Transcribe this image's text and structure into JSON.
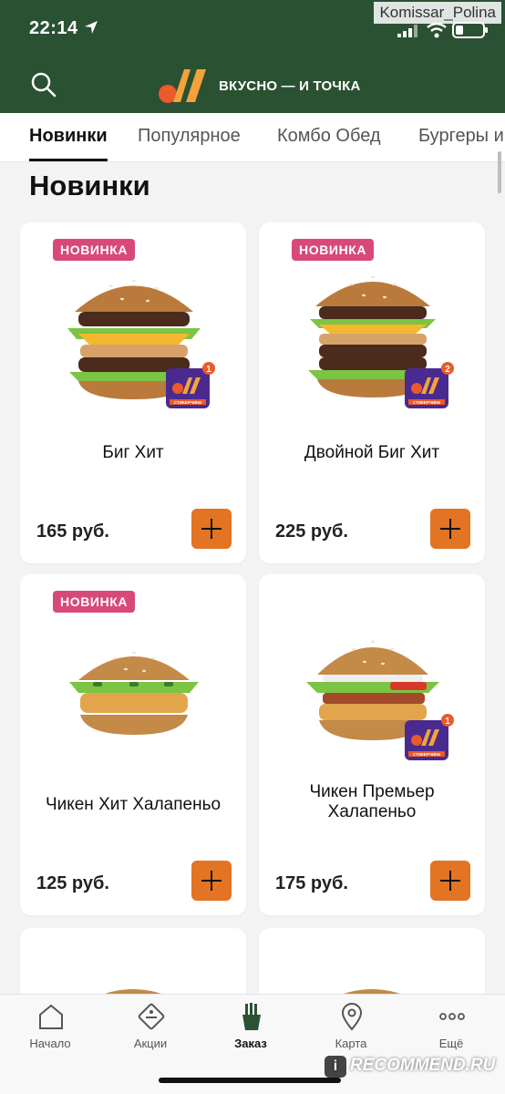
{
  "status_bar": {
    "time": "22:14",
    "watermark": "Komissar_Polina"
  },
  "header": {
    "slogan": "ВКУСНО — И ТОЧКА",
    "brand_color": "#2b5133",
    "accent_color": "#e27424"
  },
  "tabs": [
    {
      "label": "Новинки",
      "active": true
    },
    {
      "label": "Популярное",
      "active": false
    },
    {
      "label": "Комбо Обед",
      "active": false
    },
    {
      "label": "Бургеры и",
      "active": false
    }
  ],
  "section": {
    "title": "Новинки"
  },
  "products": [
    {
      "badge": "НОВИНКА",
      "name": "Биг Хит",
      "price": "165 руб.",
      "sticker_count": "1",
      "sticker_label": "СТИКЕРЧИКИ"
    },
    {
      "badge": "НОВИНКА",
      "name": "Двойной Биг Хит",
      "price": "225 руб.",
      "sticker_count": "2",
      "sticker_label": "СТИКЕРЧИКИ"
    },
    {
      "badge": "НОВИНКА",
      "name": "Чикен Хит Халапеньо",
      "price": "125 руб."
    },
    {
      "badge": "",
      "name": "Чикен Премьер Халапеньо",
      "price": "175 руб.",
      "sticker_count": "1",
      "sticker_label": "СТИКЕРЧИКИ"
    }
  ],
  "bottom_nav": [
    {
      "label": "Начало",
      "icon": "home-icon"
    },
    {
      "label": "Акции",
      "icon": "promo-icon"
    },
    {
      "label": "Заказ",
      "icon": "fries-icon",
      "active": true
    },
    {
      "label": "Карта",
      "icon": "map-pin-icon"
    },
    {
      "label": "Ещё",
      "icon": "more-icon"
    }
  ],
  "footer_watermark": "RECOMMEND.RU",
  "footer_watermark_badge": "i"
}
